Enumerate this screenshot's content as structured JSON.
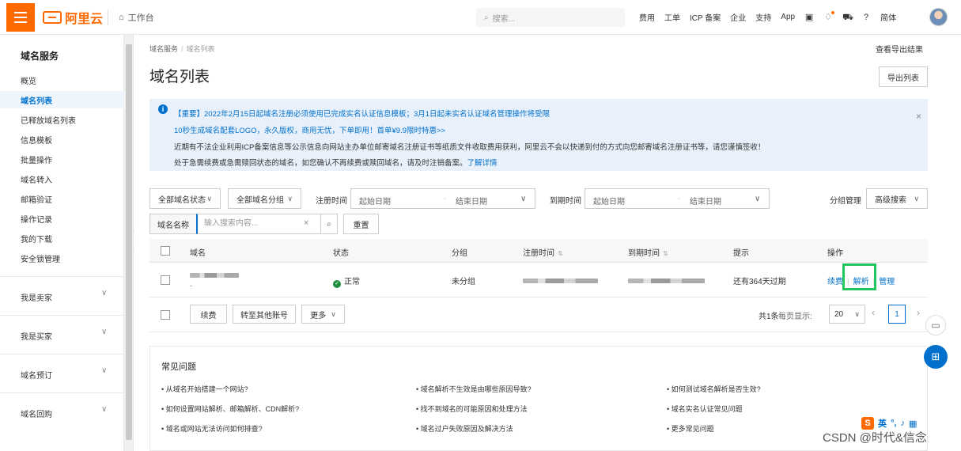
{
  "topbar": {
    "logo_text": "阿里云",
    "workbench": "工作台",
    "search_placeholder": "搜索...",
    "nav": [
      "费用",
      "工单",
      "ICP 备案",
      "企业",
      "支持",
      "App"
    ],
    "lang": "简体"
  },
  "sidebar": {
    "title": "域名服务",
    "items": [
      "概览",
      "域名列表",
      "已释放域名列表",
      "信息模板",
      "批量操作",
      "域名转入",
      "邮箱验证",
      "操作记录",
      "我的下载",
      "安全锁管理"
    ],
    "active_index": 1,
    "groups": [
      "我是卖家",
      "我是买家",
      "域名预订",
      "域名回购"
    ]
  },
  "breadcrumb": {
    "root": "域名服务",
    "current": "域名列表"
  },
  "page": {
    "title": "域名列表",
    "view_export": "查看导出结果",
    "export_button": "导出列表"
  },
  "notice": {
    "line1": "【重要】2022年2月15日起域名注册必须使用已完成实名认证信息模板；3月1日起未实名认证域名管理操作将受限",
    "line2": "10秒生成域名配套LOGO，永久版权，商用无忧，下单即用！首单¥9.9限时特惠>>",
    "line3": "近期有不法企业利用ICP备案信息等公示信息向网站主办单位邮寄域名注册证书等纸质文件收取费用获利，阿里云不会以快递到付的方式向您邮寄域名注册证书等，请您谨慎签收！",
    "line4_text": "处于急需续费或急需赎回状态的域名，如您确认不再续费或赎回域名，请及时注销备案。",
    "line4_link": "了解详情"
  },
  "filters": {
    "status": "全部域名状态",
    "group": "全部域名分组",
    "reg_time_label": "注册时间",
    "reg_start": "起始日期",
    "reg_end": "结束日期",
    "exp_time_label": "到期时间",
    "exp_start": "起始日期",
    "exp_end": "结束日期",
    "group_manage": "分组管理",
    "advanced": "高级搜索"
  },
  "search": {
    "label": "域名名称",
    "placeholder": "输入搜索内容...",
    "reset": "重置"
  },
  "table": {
    "columns": [
      "域名",
      "状态",
      "分组",
      "注册时间",
      "到期时间",
      "提示",
      "操作"
    ],
    "rows": [
      {
        "domain": "",
        "domain_sub": "-",
        "status": "正常",
        "group": "未分组",
        "hint": "还有364天过期",
        "ops": [
          "续费",
          "解析",
          "管理"
        ]
      }
    ]
  },
  "footer_actions": {
    "renew": "续费",
    "transfer": "转至其他账号",
    "more": "更多"
  },
  "pagination": {
    "total": "共1条",
    "page_size_label": "每页显示:",
    "page_size": "20",
    "current": "1"
  },
  "faq": {
    "title": "常见问题",
    "items": [
      "• 从域名开始搭建一个网站?",
      "• 域名解析不生效是由哪些原因导致?",
      "• 如何测试域名解析是否生效?",
      "• 如何设置网站解析、邮箱解析、CDN解析?",
      "• 找不到域名的可能原因和处理方法",
      "• 域名实名认证常见问题",
      "• 域名或网站无法访问如何排查?",
      "• 域名过户失败原因及解决方法",
      "• 更多常见问题"
    ]
  },
  "overlay": {
    "ime_label": "英",
    "watermark": "CSDN @时代&信念"
  },
  "colors": {
    "brand": "#ff6a00",
    "link": "#0070cc",
    "highlight": "#22c55e",
    "ok": "#1e8e3e"
  }
}
